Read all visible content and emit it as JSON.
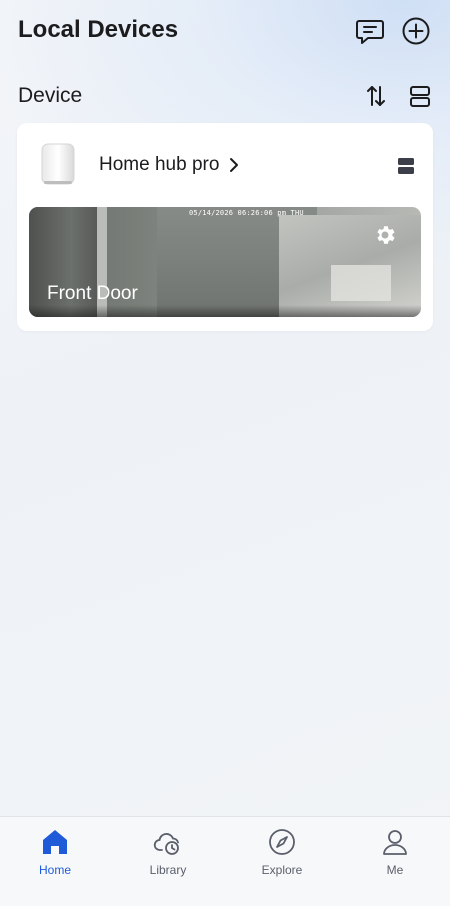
{
  "header": {
    "title": "Local Devices",
    "message_icon": "message-icon",
    "add_icon": "plus-circle-icon"
  },
  "section": {
    "title": "Device",
    "sort_icon": "sort-icon",
    "layout_icon": "layout-toggle-icon"
  },
  "hub": {
    "name": "Home hub pro",
    "camera": {
      "name": "Front Door",
      "timestamp": "05/14/2026 06:26:06 pm THU"
    }
  },
  "tabs": [
    {
      "label": "Home",
      "icon": "home-icon",
      "active": true
    },
    {
      "label": "Library",
      "icon": "cloud-clock-icon",
      "active": false
    },
    {
      "label": "Explore",
      "icon": "compass-icon",
      "active": false
    },
    {
      "label": "Me",
      "icon": "person-icon",
      "active": false
    }
  ],
  "colors": {
    "accent": "#1f5bd8",
    "text": "#1c1c1e",
    "card": "#ffffff"
  }
}
